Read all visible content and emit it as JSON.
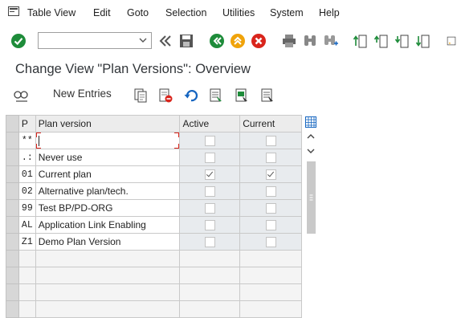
{
  "menu": {
    "items": [
      {
        "label": "Table View"
      },
      {
        "label": "Edit"
      },
      {
        "label": "Goto"
      },
      {
        "label": "Selection"
      },
      {
        "label": "Utilities"
      },
      {
        "label": "System"
      },
      {
        "label": "Help"
      }
    ]
  },
  "toolbar": {
    "command_value": "",
    "icons": [
      "enter-icon",
      "back-double-icon",
      "save-icon",
      "back-icon",
      "exit-icon",
      "cancel-icon",
      "print-icon",
      "find-icon",
      "find-next-icon",
      "first-page-icon",
      "previous-page-icon",
      "next-page-icon",
      "last-page-icon",
      "bookmark-icon"
    ]
  },
  "page": {
    "title": "Change View \"Plan Versions\": Overview"
  },
  "app_toolbar": {
    "new_entries_label": "New Entries"
  },
  "table": {
    "headers": {
      "p": "P",
      "plan_version": "Plan version",
      "active": "Active",
      "current": "Current"
    },
    "rows": [
      {
        "key": "**",
        "name": "",
        "active": false,
        "current": false
      },
      {
        "key": ".:",
        "name": "Never use",
        "active": false,
        "current": false
      },
      {
        "key": "01",
        "name": "Current plan",
        "active": true,
        "current": true
      },
      {
        "key": "02",
        "name": "Alternative plan/tech.",
        "active": false,
        "current": false
      },
      {
        "key": "99",
        "name": "Test BP/PD-ORG",
        "active": false,
        "current": false
      },
      {
        "key": "AL",
        "name": "Application Link Enabling",
        "active": false,
        "current": false
      },
      {
        "key": "Z1",
        "name": "Demo Plan Version",
        "active": false,
        "current": false
      }
    ]
  },
  "colors": {
    "accent_green": "#1e8c3a",
    "cancel_red": "#d9251c",
    "exit_orange": "#f0a30a",
    "arrow_blue": "#1565c0"
  }
}
